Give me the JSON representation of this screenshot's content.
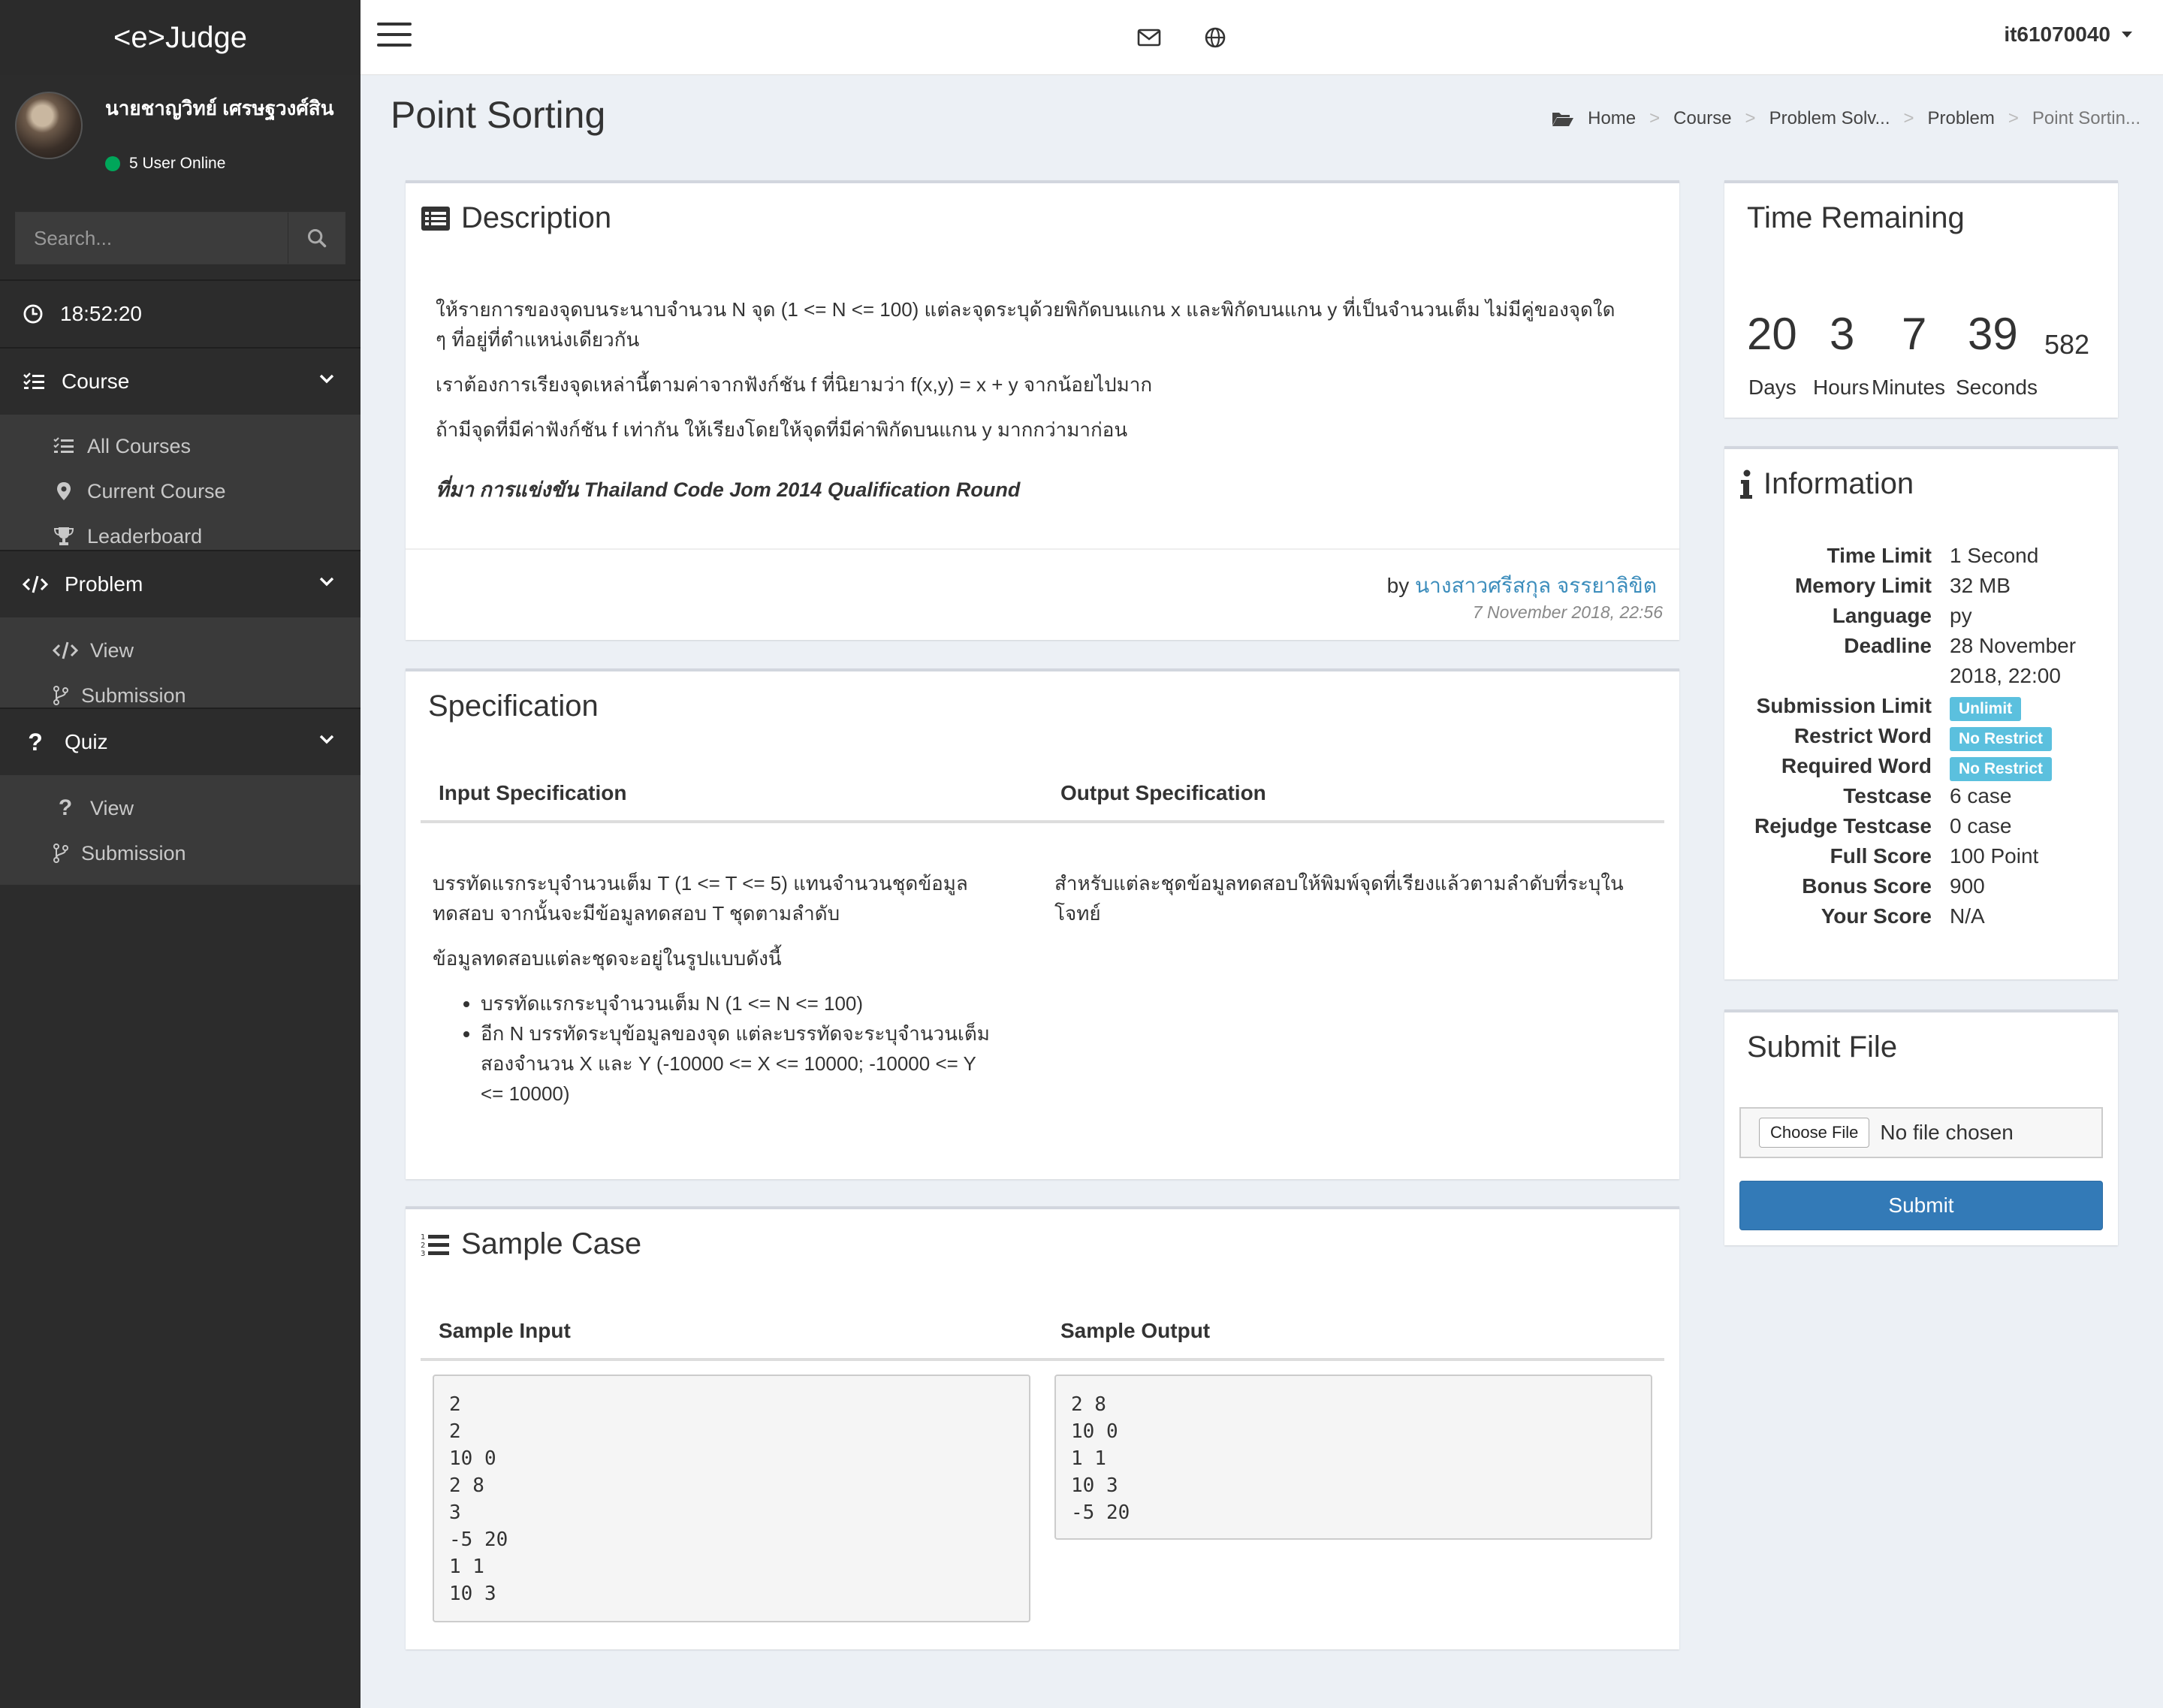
{
  "app": {
    "logo": "<e>Judge"
  },
  "user": {
    "name": "นายชาญวิทย์ เศรษฐวงศ์สิน",
    "status": "5 User Online"
  },
  "search": {
    "placeholder": "Search..."
  },
  "clock": "18:52:20",
  "sidebar": {
    "course": {
      "label": "Course",
      "items": [
        "All Courses",
        "Current Course",
        "Leaderboard"
      ]
    },
    "problem": {
      "label": "Problem",
      "items": [
        "View",
        "Submission"
      ]
    },
    "quiz": {
      "label": "Quiz",
      "items": [
        "View",
        "Submission"
      ]
    }
  },
  "topbar": {
    "username": "it61070040"
  },
  "page": {
    "title": "Point Sorting"
  },
  "breadcrumb": [
    "Home",
    "Course",
    "Problem Solv...",
    "Problem",
    "Point Sortin..."
  ],
  "description": {
    "title": "Description",
    "line1a": "ให้รายการของจุดบนระนาบจำนวน N จุด (1 <= N <= 100) แต่ละจุดระบุด้วยพิกัดบนแกน x และพิกัดบนแกน y ที่เป็นจำนวนเต็ม ไม่มีคู่ของจุดใด",
    "line1b": "ๆ ที่อยู่ที่ตำแหน่งเดียวกัน",
    "line2": "เราต้องการเรียงจุดเหล่านี้ตามค่าจากฟังก์ชัน f ที่นิยามว่า f(x,y) = x + y จากน้อยไปมาก",
    "line3": "ถ้ามีจุดที่มีค่าฟังก์ชัน f เท่ากัน ให้เรียงโดยให้จุดที่มีค่าพิกัดบนแกน y มากกว่ามาก่อน",
    "source": "ที่มา การแข่งขัน Thailand Code Jom 2014 Qualification Round",
    "by": "by",
    "author": "นางสาวศรีสกุล จรรยาลิขิต",
    "date": "7 November 2018, 22:56"
  },
  "specification": {
    "title": "Specification",
    "input_header": "Input Specification",
    "output_header": "Output Specification",
    "input_l1": "บรรทัดแรกระบุจำนวนเต็ม T (1 <= T <= 5) แทนจำนวนชุดข้อมูล",
    "input_l2": "ทดสอบ จากนั้นจะมีข้อมูลทดสอบ T ชุดตามลำดับ",
    "input_l3": "ข้อมูลทดสอบแต่ละชุดจะอยู่ในรูปแบบดังนี้",
    "bullet1": "บรรทัดแรกระบุจำนวนเต็ม N (1 <= N <= 100)",
    "bullet2a": "อีก N บรรทัดระบุข้อมูลของจุด แต่ละบรรทัดจะระบุจำนวนเต็ม",
    "bullet2b": "สองจำนวน X และ Y (-10000 <= X <= 10000; -10000 <= Y",
    "bullet2c": "<= 10000)",
    "output_l1": "สำหรับแต่ละชุดข้อมูลทดสอบให้พิมพ์จุดที่เรียงแล้วตามลำดับที่ระบุใน",
    "output_l2": "โจทย์"
  },
  "sample": {
    "title": "Sample Case",
    "input_header": "Sample Input",
    "output_header": "Sample Output",
    "input": "2\n2\n10 0\n2 8\n3\n-5 20\n1 1\n10 3",
    "output": "2 8\n10 0\n1 1\n10 3\n-5 20"
  },
  "time_remaining": {
    "title": "Time Remaining",
    "days": "20",
    "hours": "3",
    "minutes": "7",
    "seconds": "39",
    "ms": "582",
    "days_label": "Days",
    "hours_label": "Hours",
    "minutes_label": "Minutes",
    "seconds_label": "Seconds"
  },
  "information": {
    "title": "Information",
    "rows": [
      {
        "k": "Time Limit",
        "v": "1 Second"
      },
      {
        "k": "Memory Limit",
        "v": "32 MB"
      },
      {
        "k": "Language",
        "v": "py"
      },
      {
        "k": "Deadline",
        "v": "28 November"
      },
      {
        "k": "",
        "v": "2018, 22:00"
      },
      {
        "k": "Submission Limit",
        "v": "Unlimit"
      },
      {
        "k": "Restrict Word",
        "v": "No Restrict"
      },
      {
        "k": "Required Word",
        "v": "No Restrict"
      },
      {
        "k": "Testcase",
        "v": "6 case"
      },
      {
        "k": "Rejudge Testcase",
        "v": "0 case"
      },
      {
        "k": "Full Score",
        "v": "100 Point"
      },
      {
        "k": "Bonus Score",
        "v": "900"
      },
      {
        "k": "Your Score",
        "v": "N/A"
      }
    ]
  },
  "submit": {
    "title": "Submit File",
    "choose_label": "Choose File",
    "no_file": "No file chosen",
    "button": "Submit"
  },
  "colors": {
    "sidebar": "#2c2c2c",
    "submenu": "#3a3a3a",
    "primary": "#337ab7",
    "badge": "#5bc0de",
    "link": "#3c8dbc",
    "online": "#00a65a"
  }
}
